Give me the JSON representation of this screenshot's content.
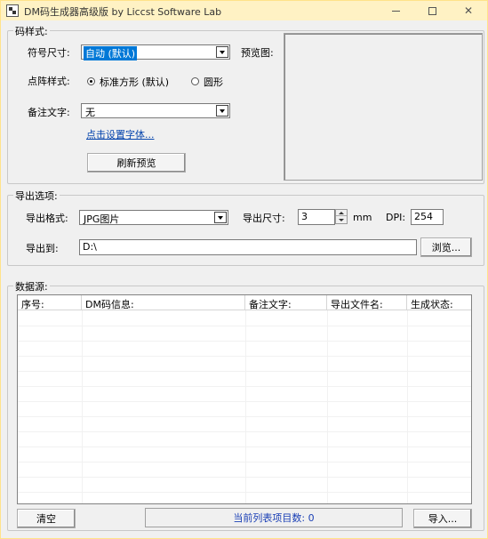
{
  "window": {
    "title": "DM码生成器高级版  by Liccst Software Lab"
  },
  "code_style": {
    "group_label": "码样式:",
    "size_label": "符号尺寸:",
    "size_value": "自动 (默认)",
    "dot_label": "点阵样式:",
    "dot_options": [
      "标准方形 (默认)",
      "圆形"
    ],
    "dot_selected_index": 0,
    "note_label": "备注文字:",
    "note_value": "无",
    "font_link": "点击设置字体...",
    "refresh_button": "刷新预览",
    "preview_label": "预览图:"
  },
  "export": {
    "group_label": "导出选项:",
    "format_label": "导出格式:",
    "format_value": "JPG图片",
    "size_label": "导出尺寸:",
    "size_value": "3",
    "unit": "mm",
    "dpi_label": "DPI:",
    "dpi_value": "254",
    "path_label": "导出到:",
    "path_value": "D:\\",
    "browse_button": "浏览..."
  },
  "data_source": {
    "group_label": "数据源:",
    "columns": [
      "序号:",
      "DM码信息:",
      "备注文字:",
      "导出文件名:",
      "生成状态:"
    ]
  },
  "footer": {
    "clear_button": "清空",
    "status_text": "当前列表项目数: 0",
    "import_button": "导入..."
  }
}
